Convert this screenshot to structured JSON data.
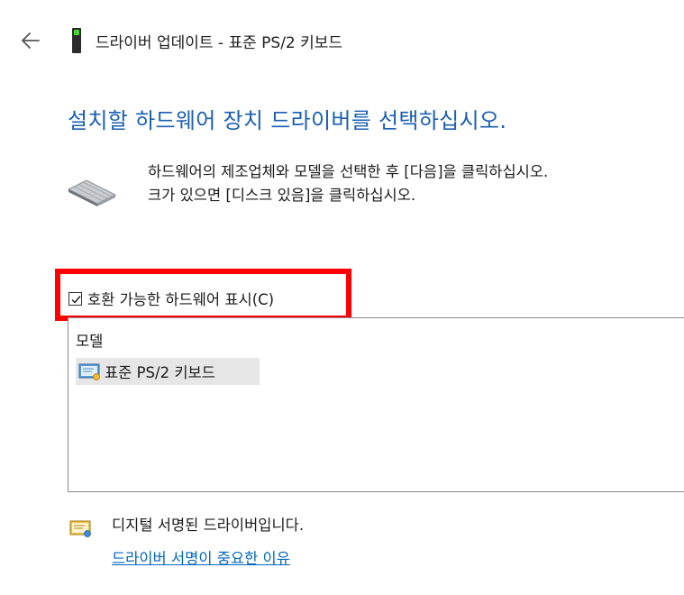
{
  "window": {
    "title": "드라이버 업데이트 - 표준 PS/2 키보드"
  },
  "main": {
    "heading": "설치할 하드웨어 장치 드라이버를 선택하십시오.",
    "description_line1": "하드웨어의 제조업체와 모델을 선택한 후 [다음]을 클릭하십시오.",
    "description_line2": "크가 있으면 [디스크 있음]을 클릭하십시오."
  },
  "compatible_checkbox": {
    "label": "호환 가능한 하드웨어 표시(C)",
    "checked": true
  },
  "model_list": {
    "header": "모델",
    "items": [
      {
        "label": "표준 PS/2 키보드",
        "selected": true
      }
    ]
  },
  "footer": {
    "signed_text": "디지털 서명된 드라이버입니다.",
    "link_text": "드라이버 서명이 중요한 이유"
  },
  "colors": {
    "heading_blue": "#1a5fb4",
    "link_blue": "#0067c0",
    "highlight_red": "#ff0000"
  }
}
